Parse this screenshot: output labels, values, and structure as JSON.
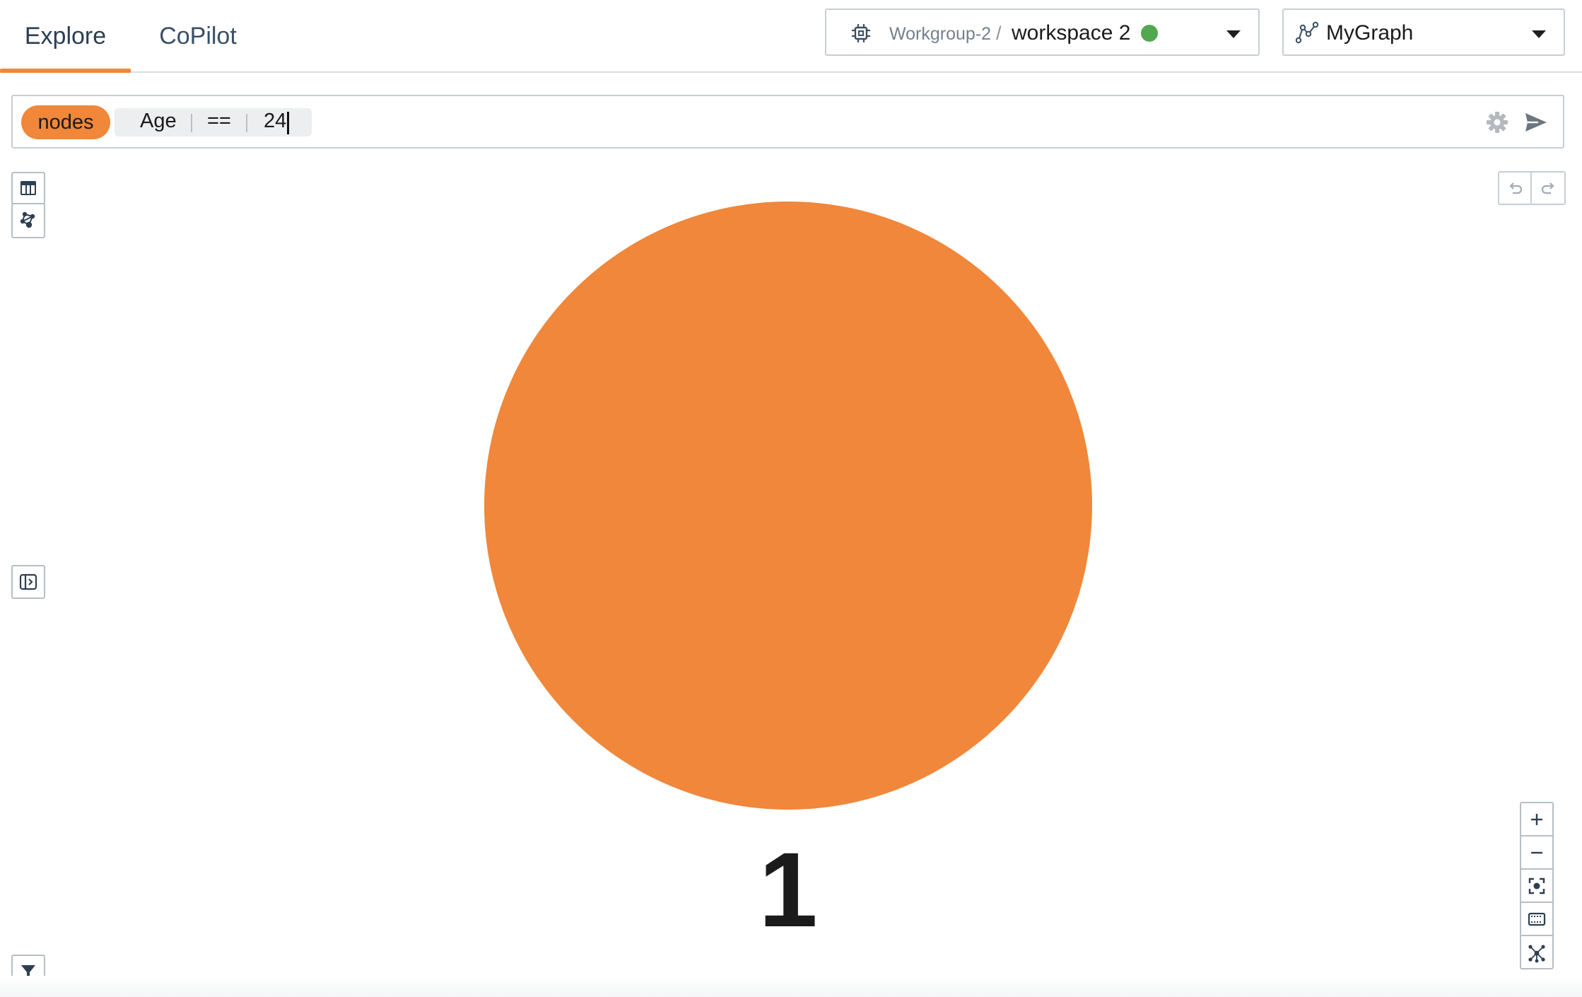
{
  "tabs": [
    {
      "label": "Explore",
      "active": true
    },
    {
      "label": "CoPilot",
      "active": false
    }
  ],
  "workspace_selector": {
    "workgroup": "Workgroup-2",
    "separator": "/",
    "workspace": "workspace 2",
    "status_color": "#52a84f"
  },
  "graph_selector": {
    "name": "MyGraph"
  },
  "query": {
    "target": "nodes",
    "field": "Age",
    "operator": "==",
    "value": "24"
  },
  "graph": {
    "node_color": "#f0873a",
    "node_label": "1"
  },
  "colors": {
    "accent": "#f0873a",
    "status_ok": "#52a84f"
  },
  "icons": {
    "table_view": "table-icon",
    "graph_view": "graph-network-icon",
    "panel_toggle": "panel-toggle-icon",
    "filter": "filter-icon",
    "settings": "gear-icon",
    "send": "send-icon",
    "undo": "undo-icon",
    "redo": "redo-icon",
    "zoom_in": "plus-icon",
    "zoom_out": "minus-icon",
    "focus": "focus-icon",
    "select_area": "selection-box-icon",
    "layout": "network-layout-icon"
  }
}
